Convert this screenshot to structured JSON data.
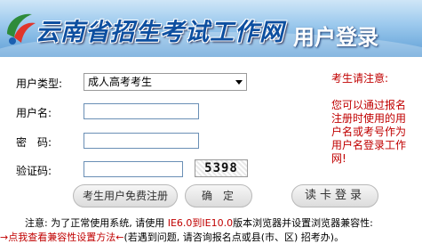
{
  "header": {
    "site_title": "云南省招生考试工作网",
    "login_title": "用户登录"
  },
  "form": {
    "usertype_label": "用户类型:",
    "usertype_value": "成人高考考生",
    "username_label": "用户名:",
    "username_value": "",
    "password_label": "密　码:",
    "password_value": "",
    "captcha_label": "验证码:",
    "captcha_value": "",
    "captcha_image_text": "5398"
  },
  "notice": {
    "title": "考生请注意:",
    "lines": [
      "您可以通过报名",
      "注册时使用的用",
      "户名或考号作为",
      "用户名登录工作",
      "网!"
    ]
  },
  "buttons": {
    "free_register": "考生用户免费注册",
    "confirm": "确定",
    "card_login": "读卡登录"
  },
  "bottom_note": {
    "line1_prefix": "注意: 为了正常使用系统, 请使用 ",
    "line1_ie": "IE6.0到IE10.0",
    "line1_suffix": "版本浏览器并设置浏览器兼容性:",
    "line2_link": "→点我查看兼容性设置方法←",
    "line2_suffix": "(若遇到问题, 请咨询报名点或县(市、区) 招考办)。"
  },
  "colors": {
    "accent_red": "#c00000",
    "banner_blue": "#5f9fd6",
    "title_blue": "#0d4fa0"
  }
}
